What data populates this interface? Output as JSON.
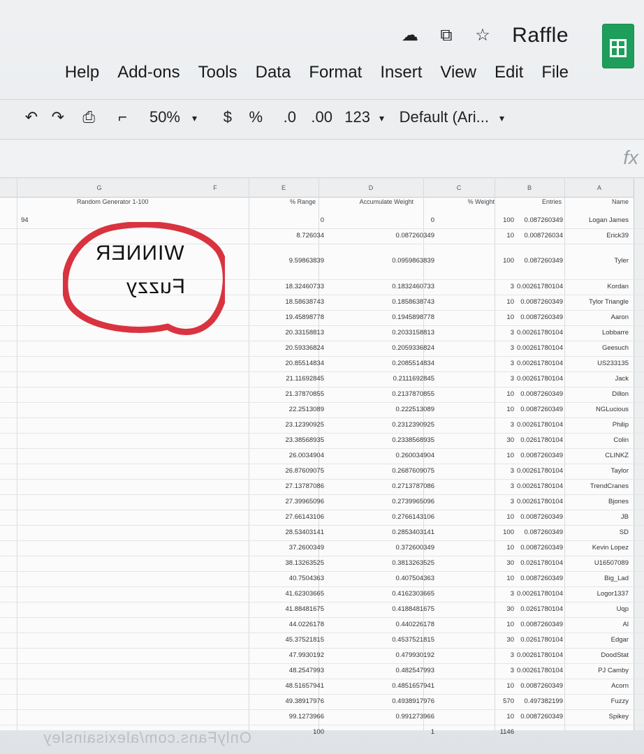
{
  "app": {
    "title": "Raffle",
    "menu": [
      "File",
      "Edit",
      "View",
      "Insert",
      "Format",
      "Data",
      "Tools",
      "Add-ons",
      "Help"
    ]
  },
  "toolbar": {
    "zoom": "50%",
    "currency": "$",
    "percent": "%",
    "decimal_less": ".0",
    "decimal_more": ".00",
    "number_format": "123",
    "font": "Default (Ari..."
  },
  "formula_bar": {
    "fx": "fx"
  },
  "columns": [
    "A",
    "B",
    "C",
    "D",
    "E",
    "F",
    "G"
  ],
  "headers": {
    "name": "Name",
    "entries": "Entries",
    "weight": "% Weight",
    "accumulate": "Accumulate Weight",
    "range": "% Range",
    "random": "Random Generator 1-100"
  },
  "random_value": "94",
  "rows": [
    {
      "name": "Logan James",
      "entries": "100",
      "weight": "0.087260349",
      "acc": "0",
      "range": "0"
    },
    {
      "name": "Erick39",
      "entries": "10",
      "weight": "0.008726034",
      "acc": "0.087260349",
      "range": "8.726034"
    },
    {
      "name": "Tyler",
      "entries": "100",
      "weight": "0.087260349",
      "acc": "0.0959863839",
      "range": "9.59863839",
      "tall": true
    },
    {
      "name": "Kordan",
      "entries": "3",
      "weight": "0.00261780104",
      "acc": "0.1832460733",
      "range": "18.32460733"
    },
    {
      "name": "Tylor Triangle",
      "entries": "10",
      "weight": "0.0087260349",
      "acc": "0.1858638743",
      "range": "18.58638743"
    },
    {
      "name": "Aaron",
      "entries": "10",
      "weight": "0.0087260349",
      "acc": "0.1945898778",
      "range": "19.45898778"
    },
    {
      "name": "Lobbarre",
      "entries": "3",
      "weight": "0.00261780104",
      "acc": "0.2033158813",
      "range": "20.33158813"
    },
    {
      "name": "Geesuch",
      "entries": "3",
      "weight": "0.00261780104",
      "acc": "0.2059336824",
      "range": "20.59336824"
    },
    {
      "name": "US233135",
      "entries": "3",
      "weight": "0.00261780104",
      "acc": "0.2085514834",
      "range": "20.85514834"
    },
    {
      "name": "Jack",
      "entries": "3",
      "weight": "0.00261780104",
      "acc": "0.2111692845",
      "range": "21.11692845"
    },
    {
      "name": "Dillon",
      "entries": "10",
      "weight": "0.0087260349",
      "acc": "0.2137870855",
      "range": "21.37870855"
    },
    {
      "name": "NGLucious",
      "entries": "10",
      "weight": "0.0087260349",
      "acc": "0.222513089",
      "range": "22.2513089"
    },
    {
      "name": "Philip",
      "entries": "3",
      "weight": "0.00261780104",
      "acc": "0.2312390925",
      "range": "23.12390925"
    },
    {
      "name": "Colin",
      "entries": "30",
      "weight": "0.0261780104",
      "acc": "0.2338568935",
      "range": "23.38568935"
    },
    {
      "name": "CLINKZ",
      "entries": "10",
      "weight": "0.0087260349",
      "acc": "0.260034904",
      "range": "26.0034904"
    },
    {
      "name": "Taylor",
      "entries": "3",
      "weight": "0.00261780104",
      "acc": "0.2687609075",
      "range": "26.87609075"
    },
    {
      "name": "TrendCranes",
      "entries": "3",
      "weight": "0.00261780104",
      "acc": "0.2713787086",
      "range": "27.13787086"
    },
    {
      "name": "Bjones",
      "entries": "3",
      "weight": "0.00261780104",
      "acc": "0.2739965096",
      "range": "27.39965096"
    },
    {
      "name": "JB",
      "entries": "10",
      "weight": "0.0087260349",
      "acc": "0.2766143106",
      "range": "27.66143106"
    },
    {
      "name": "SD",
      "entries": "100",
      "weight": "0.087260349",
      "acc": "0.2853403141",
      "range": "28.53403141"
    },
    {
      "name": "Kevin Lopez",
      "entries": "10",
      "weight": "0.0087260349",
      "acc": "0.372600349",
      "range": "37.2600349"
    },
    {
      "name": "U16507089",
      "entries": "30",
      "weight": "0.0261780104",
      "acc": "0.3813263525",
      "range": "38.13263525"
    },
    {
      "name": "Big_Lad",
      "entries": "10",
      "weight": "0.0087260349",
      "acc": "0.407504363",
      "range": "40.7504363"
    },
    {
      "name": "Logor1337",
      "entries": "3",
      "weight": "0.00261780104",
      "acc": "0.4162303665",
      "range": "41.62303665"
    },
    {
      "name": "Uqp",
      "entries": "30",
      "weight": "0.0261780104",
      "acc": "0.4188481675",
      "range": "41.88481675"
    },
    {
      "name": "Al",
      "entries": "10",
      "weight": "0.0087260349",
      "acc": "0.440226178",
      "range": "44.0226178"
    },
    {
      "name": "Edgar",
      "entries": "30",
      "weight": "0.0261780104",
      "acc": "0.4537521815",
      "range": "45.37521815"
    },
    {
      "name": "DoodStat",
      "entries": "3",
      "weight": "0.00261780104",
      "acc": "0.479930192",
      "range": "47.9930192"
    },
    {
      "name": "PJ Camby",
      "entries": "3",
      "weight": "0.00261780104",
      "acc": "0.482547993",
      "range": "48.2547993"
    },
    {
      "name": "Acorn",
      "entries": "10",
      "weight": "0.0087260349",
      "acc": "0.4851657941",
      "range": "48.51657941"
    },
    {
      "name": "Fuzzy",
      "entries": "570",
      "weight": "0.497382199",
      "acc": "0.4938917976",
      "range": "49.38917976"
    },
    {
      "name": "Spikey",
      "entries": "10",
      "weight": "0.0087260349",
      "acc": "0.991273966",
      "range": "99.1273966"
    },
    {
      "name": "",
      "entries": "1146",
      "weight": "",
      "acc": "1",
      "range": "100"
    }
  ],
  "annotation": {
    "line1": "WINNER",
    "line2": "Fuzzy",
    "circle_color": "#d9333f"
  },
  "watermark": "OnlyFans.com/alexisainsley"
}
